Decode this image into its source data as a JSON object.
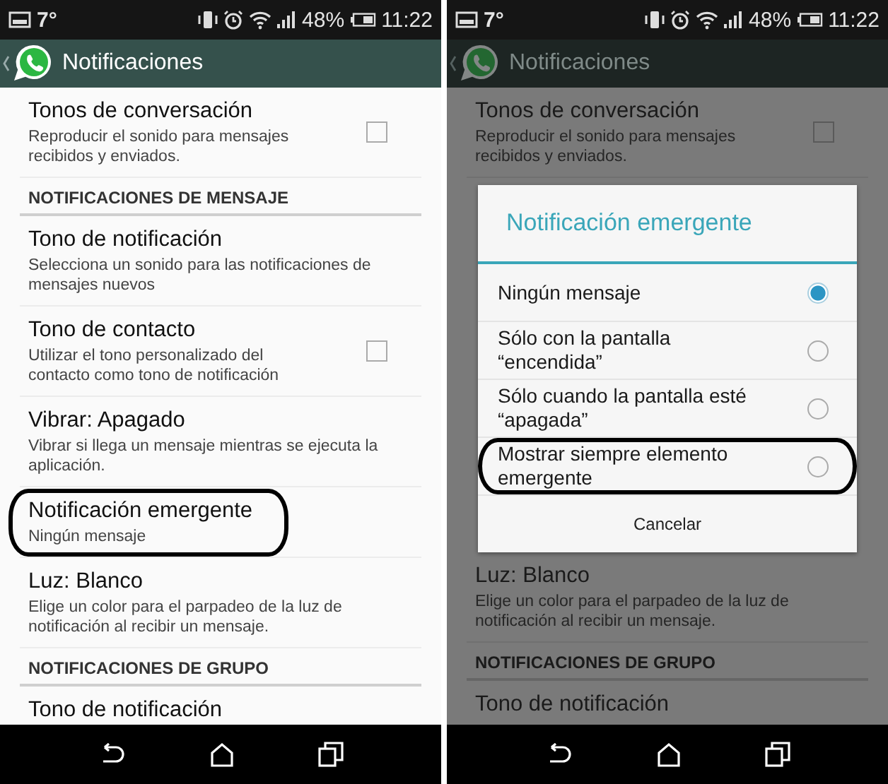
{
  "screens": [
    {
      "dimmed": false,
      "status_bar": {
        "notification": "7°",
        "battery": "48%",
        "time": "11:22"
      },
      "app_bar": {
        "title": "Notificaciones"
      },
      "items": [
        {
          "kind": "setting",
          "title": "Tonos de conversación",
          "summary": "Reproducir el sonido para mensajes recibidos y enviados.",
          "checked": false,
          "circled": false
        },
        {
          "kind": "header",
          "title": "NOTIFICACIONES DE MENSAJE"
        },
        {
          "kind": "setting",
          "title": "Tono de notificación",
          "summary": "Selecciona un sonido para las notificaciones de mensajes nuevos",
          "circled": false
        },
        {
          "kind": "setting",
          "title": "Tono de contacto",
          "summary": "Utilizar el tono personalizado del contacto como tono de notificación",
          "checked": false,
          "circled": false
        },
        {
          "kind": "setting",
          "title": "Vibrar: Apagado",
          "summary": "Vibrar si llega un mensaje mientras se ejecuta la aplicación.",
          "circled": false
        },
        {
          "kind": "setting",
          "title": "Notificación emergente",
          "summary": "Ningún mensaje",
          "circled": true
        },
        {
          "kind": "setting",
          "title": "Luz: Blanco",
          "summary": "Elige un color para el parpadeo de la luz de notificación al recibir un mensaje.",
          "circled": false
        },
        {
          "kind": "header",
          "title": "NOTIFICACIONES DE GRUPO"
        },
        {
          "kind": "setting",
          "title": "Tono de notificación",
          "circled": false
        }
      ]
    },
    {
      "dimmed": true,
      "status_bar": {
        "notification": "7°",
        "battery": "48%",
        "time": "11:22"
      },
      "app_bar": {
        "title": "Notificaciones"
      },
      "items": [
        {
          "kind": "setting",
          "title": "Tonos de conversación",
          "summary": "Reproducir el sonido para mensajes recibidos y enviados.",
          "checked": false,
          "circled": false
        },
        {
          "kind": "dialog",
          "title": "Notificación emergente",
          "options": [
            {
              "label": "Ningún mensaje",
              "selected": true,
              "circled": false
            },
            {
              "label": "Sólo con la pantalla “encendida”",
              "selected": false,
              "circled": false
            },
            {
              "label": "Sólo cuando la pantalla esté “apagada”",
              "selected": false,
              "circled": false
            },
            {
              "label": "Mostrar siempre elemento emergente",
              "selected": false,
              "circled": true
            }
          ],
          "cancel": "Cancelar"
        },
        {
          "kind": "setting",
          "title": "Luz: Blanco",
          "summary": "Elige un color para el parpadeo de la luz de notificación al recibir un mensaje.",
          "circled": false
        },
        {
          "kind": "header",
          "title": "NOTIFICACIONES DE GRUPO"
        },
        {
          "kind": "setting",
          "title": "Tono de notificación",
          "circled": false
        }
      ]
    }
  ]
}
